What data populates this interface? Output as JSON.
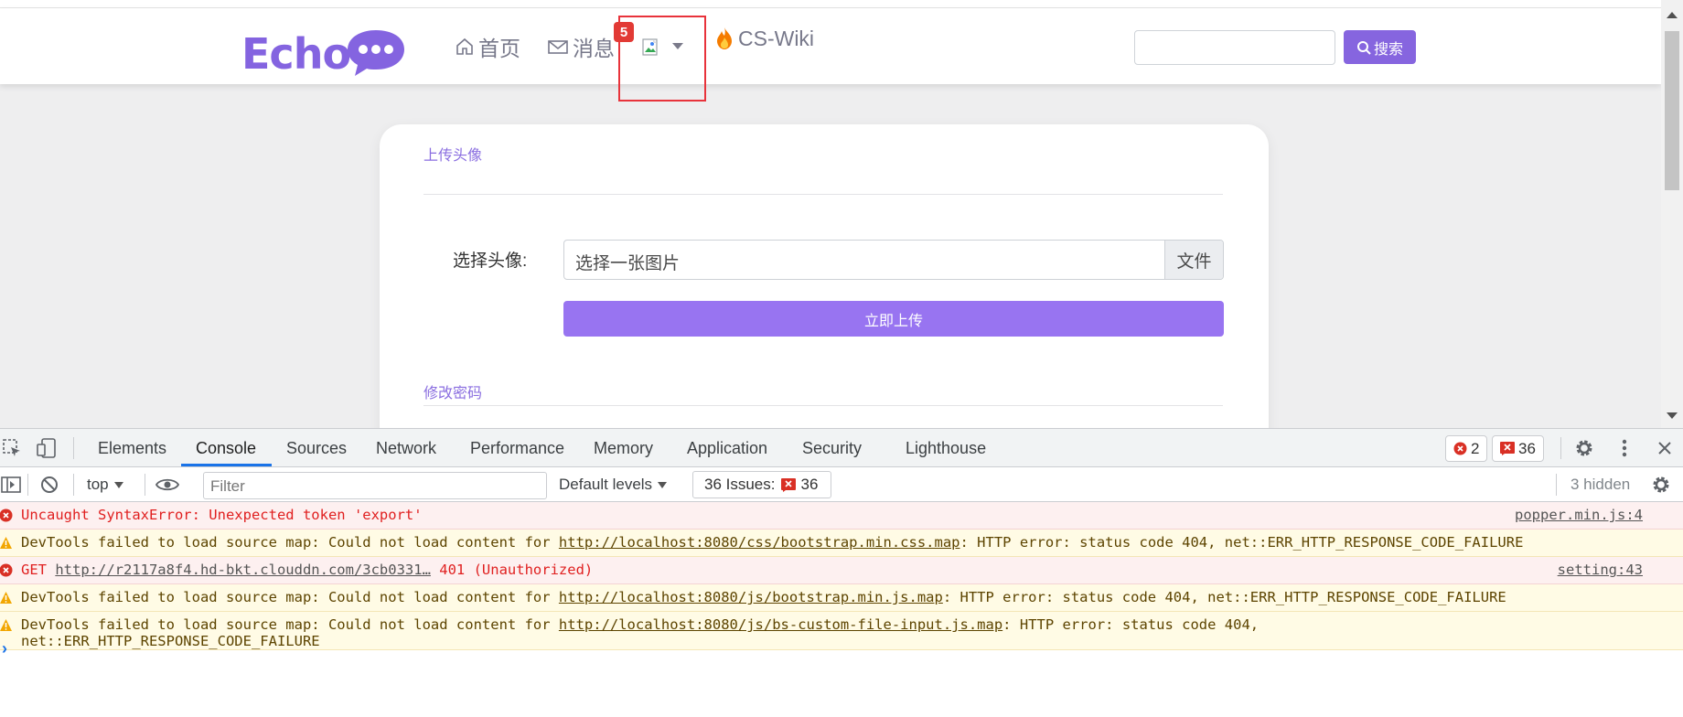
{
  "navbar": {
    "logo": "Echo",
    "nav_home": "首页",
    "nav_messages": "消息",
    "badge_count": "5",
    "nav_wiki": "CS-Wiki",
    "search_placeholder": "",
    "search_button": "搜索",
    "brand_color": "#8665df"
  },
  "card": {
    "section_avatar": "上传头像",
    "field_label": "选择头像:",
    "file_placeholder": "选择一张图片",
    "file_button": "文件",
    "upload_button": "立即上传",
    "section_password": "修改密码"
  },
  "devtools": {
    "tabs": [
      "Elements",
      "Console",
      "Sources",
      "Network",
      "Performance",
      "Memory",
      "Application",
      "Security",
      "Lighthouse"
    ],
    "active_tab": "Console",
    "error_count": "2",
    "issue_count": "36",
    "toolbar": {
      "context": "top",
      "filter_placeholder": "Filter",
      "levels": "Default levels",
      "issues_label": "36 Issues:",
      "issues_count": "36",
      "hidden": "3 hidden"
    },
    "logs": [
      {
        "level": "error",
        "text": "Uncaught SyntaxError: Unexpected token 'export'",
        "source": "popper.min.js:4"
      },
      {
        "level": "warning",
        "prefix": "DevTools failed to load source map: Could not load content for ",
        "link": "http://localhost:8080/css/bootstrap.min.css.map",
        "suffix": ": HTTP error: status code 404, net::ERR_HTTP_RESPONSE_CODE_FAILURE"
      },
      {
        "level": "error",
        "prefix": "GET ",
        "link": "http://r2117a8f4.hd-bkt.clouddn.com/3cb0331…",
        "suffix": " 401 (Unauthorized)",
        "source": "setting:43"
      },
      {
        "level": "warning",
        "prefix": "DevTools failed to load source map: Could not load content for ",
        "link": "http://localhost:8080/js/bootstrap.min.js.map",
        "suffix": ": HTTP error: status code 404, net::ERR_HTTP_RESPONSE_CODE_FAILURE"
      },
      {
        "level": "warning",
        "prefix": "DevTools failed to load source map: Could not load content for ",
        "link": "http://localhost:8080/js/bs-custom-file-input.js.map",
        "suffix": ": HTTP error: status code 404,",
        "line2": "net::ERR_HTTP_RESPONSE_CODE_FAILURE"
      }
    ],
    "prompt": "›"
  }
}
